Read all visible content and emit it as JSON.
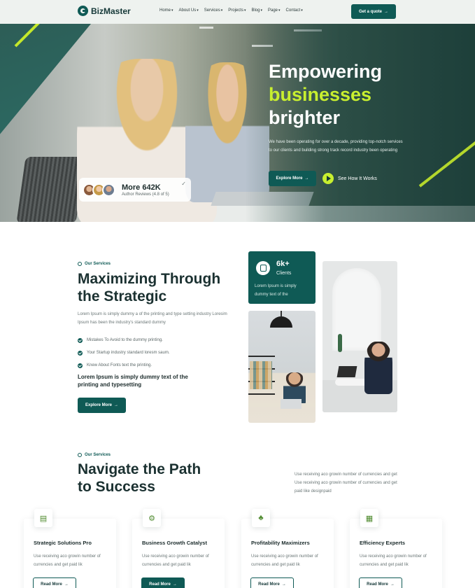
{
  "header": {
    "logo_text": "BizMaster",
    "nav": [
      "Home",
      "About Us",
      "Services",
      "Projects",
      "Blog",
      "Page",
      "Contact"
    ],
    "cta_label": "Get a quote"
  },
  "hero": {
    "title_line1": "Empowering",
    "title_highlight": "businesses",
    "title_line3": "brighter",
    "subtitle": "We have been operating for over a decade, providing top-notch services to our clients and building strong track record industry been operating",
    "primary_button": "Explore More",
    "secondary_button": "See How It Works",
    "review_count": "More 642K",
    "review_sub": "Author Reviews (4.8 of 5)"
  },
  "services": {
    "eyebrow": "Our Services",
    "title_line1": "Maximizing Through",
    "title_line2": "the Strategic",
    "description": "Lorem Ipsum is simply dummy a of the printing and type setting industry Loresim Ipsum has been the industry's standard dummy",
    "checklist": [
      "Mistakes To Avoid to the dummy printing.",
      "Your Startup industry standard loresm saum.",
      "Knew About Fonts text the printing."
    ],
    "bold_blurb": "Lorem Ipsum is simply dummy text of the printing and typesetting",
    "button": "Explore More",
    "clients_number": "6k+",
    "clients_label": "Clients",
    "clients_desc": "Lorem Ipsum is simply dummy text of the"
  },
  "navigate": {
    "eyebrow": "Our Services",
    "title_line1": "Navigate the Path",
    "title_line2": "to Success",
    "description": "Use receiving aco growin number of currencies and get Use receiving aco growin number of currencies and get paid like designpaid",
    "cards": [
      {
        "title": "Strategic Solutions Pro",
        "desc": "Use receiving aco growin number of currencies and get paid lik",
        "button": "Read More",
        "icon": "document-icon"
      },
      {
        "title": "Business Growth Catalyst",
        "desc": "Use receiving aco growin number of currencies and get paid lik",
        "button": "Read More",
        "icon": "gear-icon"
      },
      {
        "title": "Profitability Maximizers",
        "desc": "Use receiving aco growin number of currencies and get paid lik",
        "button": "Read More",
        "icon": "chart-icon"
      },
      {
        "title": "Efficiency Experts",
        "desc": "Use receiving aco growin number of currencies and get paid lik",
        "button": "Read More",
        "icon": "analytics-icon"
      }
    ]
  },
  "colors": {
    "brand": "#0f5a55",
    "accent": "#c8ef2f"
  },
  "glyphs": {
    "caret": "▾",
    "arrow": "→",
    "check": "✓"
  }
}
